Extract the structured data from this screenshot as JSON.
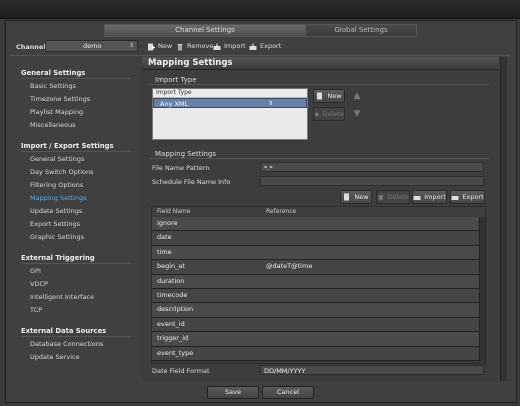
{
  "tabs": [
    "Channel Settings",
    "Global Settings"
  ],
  "channel": {
    "label": "Channel",
    "value": "demo"
  },
  "toolbar": {
    "new": "New",
    "remove": "Remove",
    "import": "Import",
    "export": "Export"
  },
  "nav": {
    "general": {
      "title": "General Settings",
      "items": [
        "Basic Settings",
        "Timezone Settings",
        "Playlist Mapping",
        "Miscellaneous"
      ]
    },
    "import_export": {
      "title": "Import / Export Settings",
      "items": [
        "General Settings",
        "Day Switch Options",
        "Filtering Options",
        "Mapping Settings",
        "Update Settings",
        "Export Settings",
        "Graphic Settings"
      ]
    },
    "external_triggering": {
      "title": "External Triggering",
      "items": [
        "GPI",
        "VDCP",
        "Intelligent Interface",
        "TCP"
      ]
    },
    "external_data": {
      "title": "External Data Sources",
      "items": [
        "Database Connections",
        "Update Service"
      ]
    }
  },
  "panel": {
    "title": "Mapping Settings",
    "import_type": {
      "section": "Import Type",
      "column": "Import Type",
      "selected": "Any XML",
      "new": "New",
      "delete": "Delete"
    },
    "mapping": {
      "section": "Mapping Settings",
      "file_name_pattern_label": "File Name Pattern",
      "file_name_pattern_value": "*.*",
      "schedule_file_name_info_label": "Schedule File Name Info",
      "schedule_file_name_info_value": "",
      "new": "New",
      "delete": "Delete",
      "import": "Import",
      "export": "Export",
      "columns": [
        "Field Name",
        "Reference"
      ],
      "rows": [
        [
          "ignore",
          ""
        ],
        [
          "date",
          ""
        ],
        [
          "time",
          ""
        ],
        [
          "begin_at",
          "@dateT@time"
        ],
        [
          "duration",
          ""
        ],
        [
          "timecode",
          ""
        ],
        [
          "description",
          ""
        ],
        [
          "event_id",
          ""
        ],
        [
          "trigger_id",
          ""
        ],
        [
          "event_type",
          ""
        ]
      ],
      "date_format_label": "Date Field Format",
      "date_format_value": "DD/MM/YYYY"
    }
  },
  "footer": {
    "save": "Save",
    "cancel": "Cancel"
  }
}
